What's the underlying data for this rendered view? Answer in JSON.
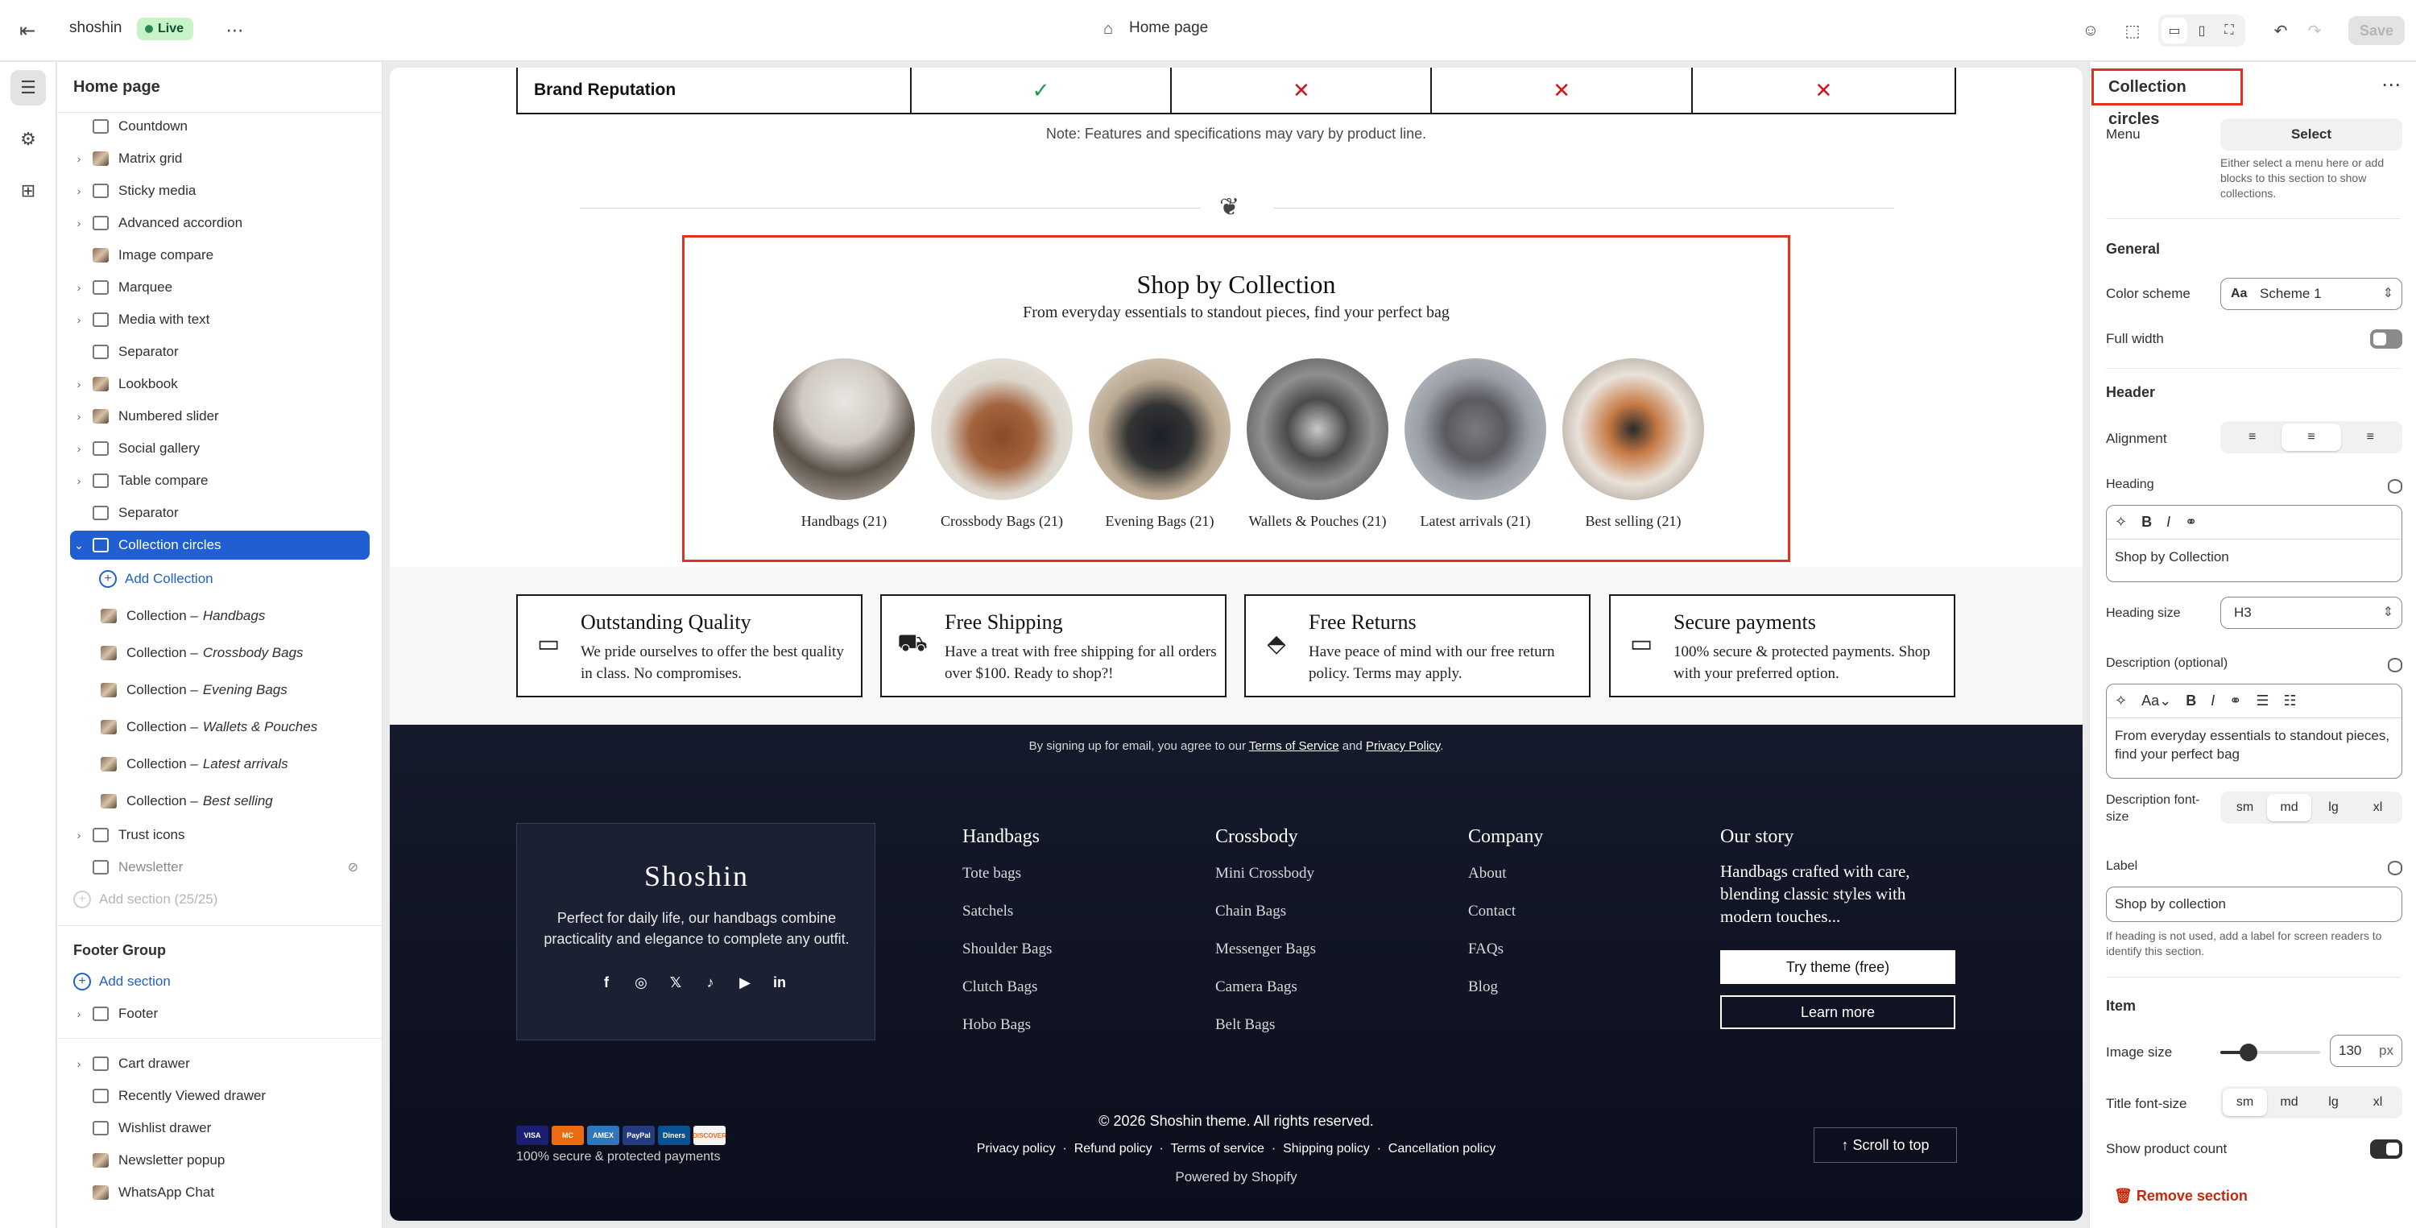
{
  "topbar": {
    "store_name": "shoshin",
    "status": "Live",
    "page_title": "Home page",
    "save_label": "Save"
  },
  "sidebar": {
    "title": "Home page",
    "sections": [
      {
        "label": "Countdown"
      },
      {
        "label": "Matrix grid"
      },
      {
        "label": "Sticky media"
      },
      {
        "label": "Advanced accordion"
      },
      {
        "label": "Image compare"
      },
      {
        "label": "Marquee"
      },
      {
        "label": "Media with text"
      },
      {
        "label": "Separator"
      },
      {
        "label": "Lookbook"
      },
      {
        "label": "Numbered slider"
      },
      {
        "label": "Social gallery"
      },
      {
        "label": "Table compare"
      },
      {
        "label": "Separator"
      },
      {
        "label": "Collection circles"
      }
    ],
    "add_collection": "Add Collection",
    "collection_prefix": "Collection – ",
    "collections": [
      "Handbags",
      "Crossbody Bags",
      "Evening Bags",
      "Wallets & Pouches",
      "Latest arrivals",
      "Best selling"
    ],
    "trust_icons": "Trust icons",
    "newsletter": "Newsletter",
    "add_section_disabled": "Add section (25/25)",
    "footer_group": "Footer Group",
    "add_section": "Add section",
    "footer": "Footer",
    "overlays": [
      "Cart drawer",
      "Recently Viewed drawer",
      "Wishlist drawer",
      "Newsletter popup",
      "WhatsApp Chat"
    ]
  },
  "preview": {
    "compare_row": {
      "label": "Brand Reputation",
      "marks": [
        "✓",
        "✕",
        "✕",
        "✕"
      ]
    },
    "note": "Note: Features and specifications may vary by product line.",
    "shop": {
      "title": "Shop by Collection",
      "subtitle": "From everyday essentials to standout pieces, find your perfect bag",
      "items": [
        "Handbags (21)",
        "Crossbody Bags (21)",
        "Evening Bags (21)",
        "Wallets & Pouches (21)",
        "Latest arrivals (21)",
        "Best selling (21)"
      ]
    },
    "features": [
      {
        "title": "Outstanding Quality",
        "desc": "We pride ourselves to offer the best quality in class. No compromises."
      },
      {
        "title": "Free Shipping",
        "desc": "Have a treat with free shipping for all orders over $100. Ready to shop?!"
      },
      {
        "title": "Free Returns",
        "desc": "Have peace of mind with our free return policy. Terms may apply."
      },
      {
        "title": "Secure payments",
        "desc": "100% secure & protected payments. Shop with your preferred option."
      }
    ],
    "footer": {
      "consent_pre": "By signing up for email, you agree to our",
      "terms": "Terms of Service",
      "and": "and",
      "privacy": "Privacy Policy",
      "brand": "Shoshin",
      "tagline": "Perfect for daily life, our handbags combine practicality and elegance to complete any outfit.",
      "columns": [
        {
          "heading": "Handbags",
          "links": [
            "Tote bags",
            "Satchels",
            "Shoulder Bags",
            "Clutch Bags",
            "Hobo Bags"
          ]
        },
        {
          "heading": "Crossbody",
          "links": [
            "Mini Crossbody",
            "Chain Bags",
            "Messenger Bags",
            "Camera Bags",
            "Belt Bags"
          ]
        },
        {
          "heading": "Company",
          "links": [
            "About",
            "Contact",
            "FAQs",
            "Blog"
          ]
        }
      ],
      "story_heading": "Our story",
      "story_text": "Handbags crafted with care, blending classic styles with modern touches...",
      "try_button": "Try theme (free)",
      "learn_button": "Learn more",
      "pay_text": "100% secure & protected payments",
      "pay_icons": [
        "VISA",
        "MC",
        "AMEX",
        "PayPal",
        "Diners",
        "DISCOVER"
      ],
      "copyright": "© 2026 Shoshin theme. All rights reserved.",
      "policies": [
        "Privacy policy",
        "Refund policy",
        "Terms of service",
        "Shipping policy",
        "Cancellation policy"
      ],
      "powered": "Powered by Shopify",
      "scroll_top": "Scroll to top"
    }
  },
  "panel": {
    "title": "Collection circles",
    "menu_label": "Menu",
    "menu_select": "Select",
    "menu_help": "Either select a menu here or add blocks to this section to show collections.",
    "general": "General",
    "color_scheme_label": "Color scheme",
    "color_scheme_value": "Scheme 1",
    "full_width_label": "Full width",
    "header": "Header",
    "alignment_label": "Alignment",
    "heading_label": "Heading",
    "heading_value": "Shop by Collection",
    "heading_size_label": "Heading size",
    "heading_size_value": "H3",
    "description_label": "Description (optional)",
    "description_value": "From everyday essentials to standout pieces, find your perfect bag",
    "desc_font_label": "Description font-size",
    "sizes": [
      "sm",
      "md",
      "lg",
      "xl"
    ],
    "label_label": "Label",
    "label_value": "Shop by collection",
    "label_help": "If heading is not used, add a label for screen readers to identify this section.",
    "item": "Item",
    "image_size_label": "Image size",
    "image_size_value": "130",
    "image_size_unit": "px",
    "title_font_label": "Title font-size",
    "show_count_label": "Show product count",
    "remove_label": "Remove section"
  }
}
